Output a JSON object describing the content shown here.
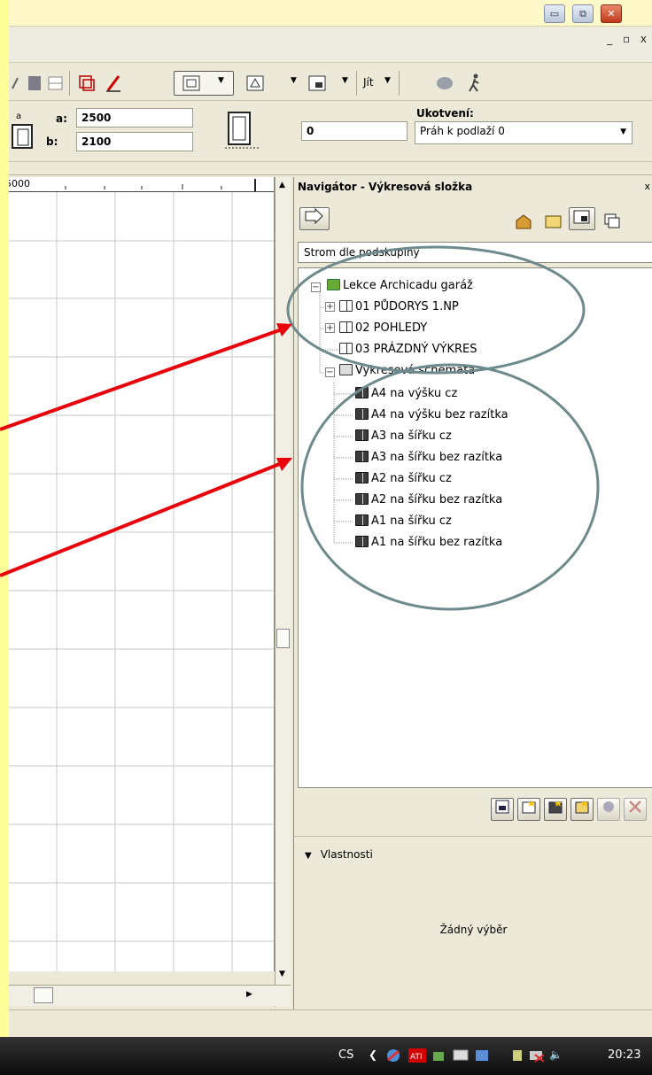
{
  "window": {
    "minimize_glyph": "▭",
    "restore_glyph": "⧉",
    "close_glyph": "✕"
  },
  "menubar": {
    "mdi_controls": "_ ▫ x"
  },
  "toolbar": {
    "goto_label": "Jít"
  },
  "infobox": {
    "a_label": "a:",
    "a_value": "2500",
    "b_label": "b:",
    "b_value": "2100",
    "height_value": "0",
    "anchor_label": "Ukotvení:",
    "anchor_value": "Práh k podlaží 0"
  },
  "ruler": {
    "value": "5000"
  },
  "navigator": {
    "title": "Navigátor - Výkresová složka",
    "view_mode": "Strom dle podskupiny",
    "tree": {
      "root": "Lekce Archicadu garáž",
      "groups": [
        "01 PŮDORYS 1.NP",
        "02 POHLEDY",
        "03 PRÁZDNÝ VÝKRES"
      ],
      "schemes_label": "Výkresová schemata",
      "schemes": [
        "A4 na výšku cz",
        "A4 na výšku bez razítka",
        "A3 na šířku cz",
        "A3 na šířku bez razítka",
        "A2 na šířku cz",
        "A2 na šířku bez razítka",
        "A1 na šířku cz",
        "A1 na šířku bez razítka"
      ]
    },
    "properties_label": "Vlastnosti",
    "no_selection": "Žádný výběr"
  },
  "taskbar": {
    "language": "CS",
    "clock": "20:23"
  },
  "colors": {
    "highlight_yellow": "#ffff99",
    "annotation_red": "#e8000b",
    "annotation_circle": "#6f8a8c"
  }
}
